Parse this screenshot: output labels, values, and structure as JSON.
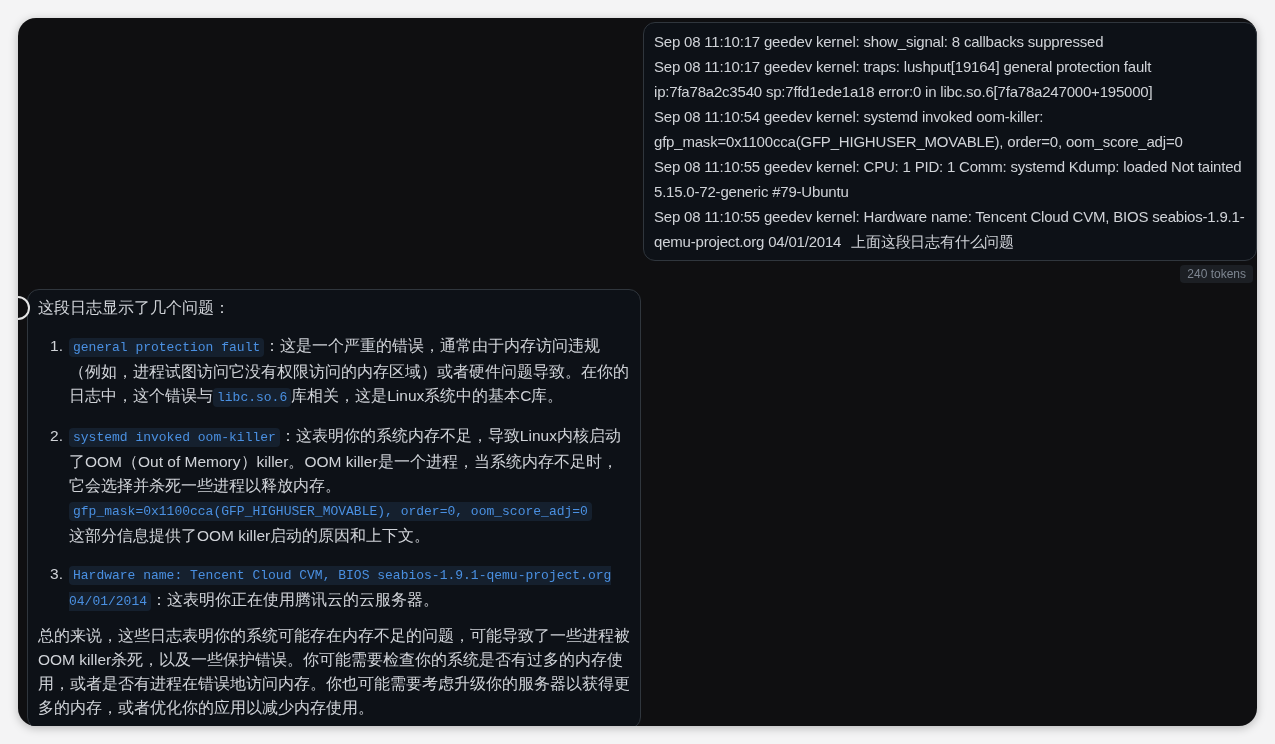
{
  "user_message": {
    "lines": [
      "Sep 08 11:10:17 geedev kernel: show_signal: 8 callbacks suppressed",
      "Sep 08 11:10:17 geedev kernel: traps: lushput[19164] general protection fault ip:7fa78a2c3540 sp:7ffd1ede1a18 error:0 in libc.so.6[7fa78a247000+195000]",
      "Sep 08 11:10:54 geedev kernel: systemd invoked oom-killer: gfp_mask=0x1100cca(GFP_HIGHUSER_MOVABLE), order=0, oom_score_adj=0",
      "Sep 08 11:10:55 geedev kernel: CPU: 1 PID: 1 Comm: systemd Kdump: loaded Not tainted 5.15.0-72-generic #79-Ubuntu",
      "Sep 08 11:10:55 geedev kernel: Hardware name: Tencent Cloud CVM, BIOS seabios-1.9.1-qemu-project.org 04/01/2014"
    ],
    "question": "上面这段日志有什么问题"
  },
  "token_count": "240 tokens",
  "assistant_message": {
    "intro": "这段日志显示了几个问题：",
    "items": [
      {
        "number": "1.",
        "segments": [
          {
            "kind": "code",
            "text": "general protection fault"
          },
          {
            "kind": "text",
            "text": "：这是一个严重的错误，通常由于内存访问违规（例如，进程试图访问它没有权限访问的内存区域）或者硬件问题导致。在你的日志中，这个错误与"
          },
          {
            "kind": "code",
            "text": "libc.so.6"
          },
          {
            "kind": "text",
            "text": "库相关，这是Linux系统中的基本C库。"
          }
        ]
      },
      {
        "number": "2.",
        "segments": [
          {
            "kind": "code",
            "text": "systemd invoked oom-killer"
          },
          {
            "kind": "text",
            "text": "：这表明你的系统内存不足，导致Linux内核启动了OOM（Out of Memory）killer。OOM killer是一个进程，当系统内存不足时，它会选择并杀死一些进程以释放内存。"
          },
          {
            "kind": "code",
            "text": "gfp_mask=0x1100cca(GFP_HIGHUSER_MOVABLE), order=0, oom_score_adj=0"
          },
          {
            "kind": "text",
            "text": "这部分信息提供了OOM killer启动的原因和上下文。"
          }
        ]
      },
      {
        "number": "3.",
        "segments": [
          {
            "kind": "code",
            "text": "Hardware name: Tencent Cloud CVM, BIOS seabios-1.9.1-qemu-project.org 04/01/2014"
          },
          {
            "kind": "text",
            "text": "：这表明你正在使用腾讯云的云服务器。"
          }
        ]
      }
    ],
    "summary": "总的来说，这些日志表明你的系统可能存在内存不足的问题，可能导致了一些进程被OOM killer杀死，以及一些保护错误。你可能需要检查你的系统是否有过多的内存使用，或者是否有进程在错误地访问内存。你也可能需要考虑升级你的服务器以获得更多的内存，或者优化你的应用以减少内存使用。"
  }
}
